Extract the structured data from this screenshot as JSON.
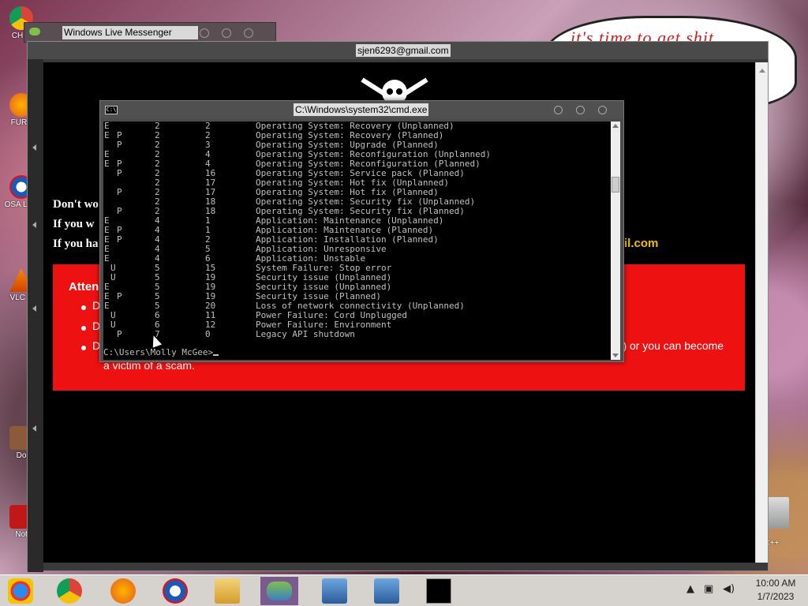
{
  "desktop": {
    "icons": [
      {
        "name": "chrome-desktop-icon",
        "label": "CH\nD"
      },
      {
        "name": "firefox-desktop-icon",
        "label": "FURF"
      },
      {
        "name": "osaka-desktop-icon",
        "label": "OSA\nLAD"
      },
      {
        "name": "vlc-desktop-icon",
        "label": "VLC\nP"
      },
      {
        "name": "doc-desktop-icon",
        "label": "Do"
      },
      {
        "name": "not-desktop-icon",
        "label": "Not"
      }
    ],
    "speech_text": "it's time to get shit",
    "speech_te": "te",
    "recycle_label": "n C++"
  },
  "messenger": {
    "title": "Windows Live Messenger"
  },
  "browser": {
    "title": "sjen6293@gmail.com",
    "lines": [
      "Don't wo",
      "If you w",
      "If you ha"
    ],
    "email_tail": "il.com",
    "attention": "Atten",
    "bullets": [
      "D",
      "D",
      "D"
    ],
    "tail_text": "ur) or you can become",
    "tail_text2": "a victim of a scam."
  },
  "cmd": {
    "title": "C:\\Windows\\system32\\cmd.exe",
    "rows": [
      {
        "e": "E",
        "p": "",
        "u": "",
        "maj": "2",
        "min": "2",
        "desc": "Operating System: Recovery (Unplanned)"
      },
      {
        "e": "E",
        "p": "P",
        "u": "",
        "maj": "2",
        "min": "2",
        "desc": "Operating System: Recovery (Planned)"
      },
      {
        "e": "",
        "p": "P",
        "u": "",
        "maj": "2",
        "min": "3",
        "desc": "Operating System: Upgrade (Planned)"
      },
      {
        "e": "E",
        "p": "",
        "u": "",
        "maj": "2",
        "min": "4",
        "desc": "Operating System: Reconfiguration (Unplanned)"
      },
      {
        "e": "E",
        "p": "P",
        "u": "",
        "maj": "2",
        "min": "4",
        "desc": "Operating System: Reconfiguration (Planned)"
      },
      {
        "e": "",
        "p": "P",
        "u": "",
        "maj": "2",
        "min": "16",
        "desc": "Operating System: Service pack (Planned)"
      },
      {
        "e": "",
        "p": "",
        "u": "",
        "maj": "2",
        "min": "17",
        "desc": "Operating System: Hot fix (Unplanned)"
      },
      {
        "e": "",
        "p": "P",
        "u": "",
        "maj": "2",
        "min": "17",
        "desc": "Operating System: Hot fix (Planned)"
      },
      {
        "e": "",
        "p": "",
        "u": "",
        "maj": "2",
        "min": "18",
        "desc": "Operating System: Security fix (Unplanned)"
      },
      {
        "e": "",
        "p": "P",
        "u": "",
        "maj": "2",
        "min": "18",
        "desc": "Operating System: Security fix (Planned)"
      },
      {
        "e": "E",
        "p": "",
        "u": "",
        "maj": "4",
        "min": "1",
        "desc": "Application: Maintenance (Unplanned)"
      },
      {
        "e": "E",
        "p": "P",
        "u": "",
        "maj": "4",
        "min": "1",
        "desc": "Application: Maintenance (Planned)"
      },
      {
        "e": "E",
        "p": "P",
        "u": "",
        "maj": "4",
        "min": "2",
        "desc": "Application: Installation (Planned)"
      },
      {
        "e": "E",
        "p": "",
        "u": "",
        "maj": "4",
        "min": "5",
        "desc": "Application: Unresponsive"
      },
      {
        "e": "E",
        "p": "",
        "u": "",
        "maj": "4",
        "min": "6",
        "desc": "Application: Unstable"
      },
      {
        "e": "",
        "p": "",
        "u": "U",
        "maj": "5",
        "min": "15",
        "desc": "System Failure: Stop error"
      },
      {
        "e": "",
        "p": "",
        "u": "U",
        "maj": "5",
        "min": "19",
        "desc": "Security issue (Unplanned)"
      },
      {
        "e": "E",
        "p": "",
        "u": "",
        "maj": "5",
        "min": "19",
        "desc": "Security issue (Unplanned)"
      },
      {
        "e": "E",
        "p": "P",
        "u": "",
        "maj": "5",
        "min": "19",
        "desc": "Security issue (Planned)"
      },
      {
        "e": "E",
        "p": "",
        "u": "",
        "maj": "5",
        "min": "20",
        "desc": "Loss of network connectivity (Unplanned)"
      },
      {
        "e": "",
        "p": "",
        "u": "U",
        "maj": "6",
        "min": "11",
        "desc": "Power Failure: Cord Unplugged"
      },
      {
        "e": "",
        "p": "",
        "u": "U",
        "maj": "6",
        "min": "12",
        "desc": "Power Failure: Environment"
      },
      {
        "e": "",
        "p": "P",
        "u": "",
        "maj": "7",
        "min": "0",
        "desc": "Legacy API shutdown"
      }
    ],
    "prompt": "C:\\Users\\Molly McGee>"
  },
  "taskbar": {
    "items": [
      "start-button",
      "chrome-taskbar-icon",
      "firefox-taskbar-icon",
      "obama-taskbar-icon",
      "file-explorer-taskbar-icon",
      "messenger-taskbar-icon",
      "remote-desktop-taskbar-icon",
      "remote-desktop-2-taskbar-icon",
      "cmd-taskbar-icon"
    ],
    "time": "10:00 AM",
    "date": "1/7/2023"
  },
  "colors": {
    "cmd_text": "#c0c0c0",
    "scam_red": "#ee1111",
    "scam_email": "#f0c000",
    "taskbar_active": "#7b5a8f"
  }
}
